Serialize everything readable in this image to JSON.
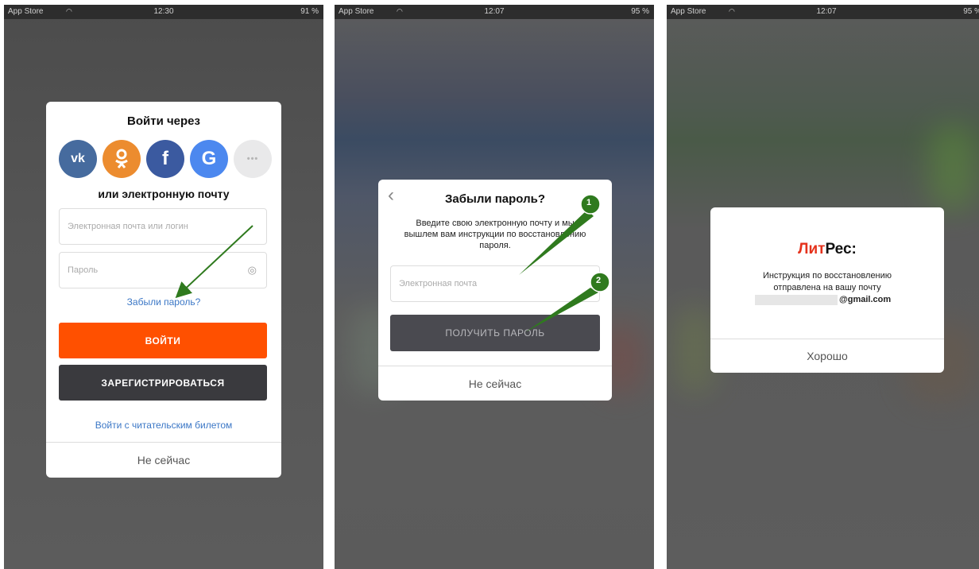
{
  "statusbar": [
    {
      "carrier": "App Store",
      "time": "12:30",
      "battery": "91 %"
    },
    {
      "carrier": "App Store",
      "time": "12:07",
      "battery": "95 %"
    },
    {
      "carrier": "App Store",
      "time": "12:07",
      "battery": "95 %"
    }
  ],
  "login": {
    "title": "Войти через",
    "social": [
      {
        "icon": "vk-icon",
        "label": "vk",
        "color": "#466b9e"
      },
      {
        "icon": "odnoklassniki-icon",
        "label": "ok",
        "color": "#ec8c2f"
      },
      {
        "icon": "facebook-icon",
        "label": "f",
        "color": "#3b5aa0"
      },
      {
        "icon": "google-icon",
        "label": "G",
        "color": "#4c88ef"
      },
      {
        "icon": "more-icon",
        "label": "•••",
        "color": "#e9e9ea"
      }
    ],
    "or_email": "или электронную почту",
    "email_placeholder": "Электронная почта или логин",
    "password_placeholder": "Пароль",
    "forgot_link": "Забыли пароль?",
    "login_button": "ВОЙТИ",
    "register_button": "ЗАРЕГИСТРИРОВАТЬСЯ",
    "reader_ticket_link": "Войти с читательским билетом",
    "not_now": "Не сейчас",
    "colors": {
      "login": "#ff5000",
      "register": "#3a3a3e",
      "link": "#3b77c6"
    }
  },
  "forgot": {
    "title": "Забыли пароль?",
    "description": "Введите свою электронную почту и мы вышлем вам инструкции по восстановлению пароля.",
    "email_placeholder": "Электронная почта",
    "get_password_button": "ПОЛУЧИТЬ ПАРОЛЬ",
    "not_now": "Не сейчас",
    "markers": [
      "1",
      "2"
    ]
  },
  "sent": {
    "logo_part1": "Лит",
    "logo_part2": "Рес:",
    "message_line1": "Инструкция по восстановлению",
    "message_line2": "отправлена на вашу почту",
    "email_suffix": "@gmail.com",
    "ok_button": "Хорошо",
    "colors": {
      "logo_red": "#e5321c"
    }
  }
}
